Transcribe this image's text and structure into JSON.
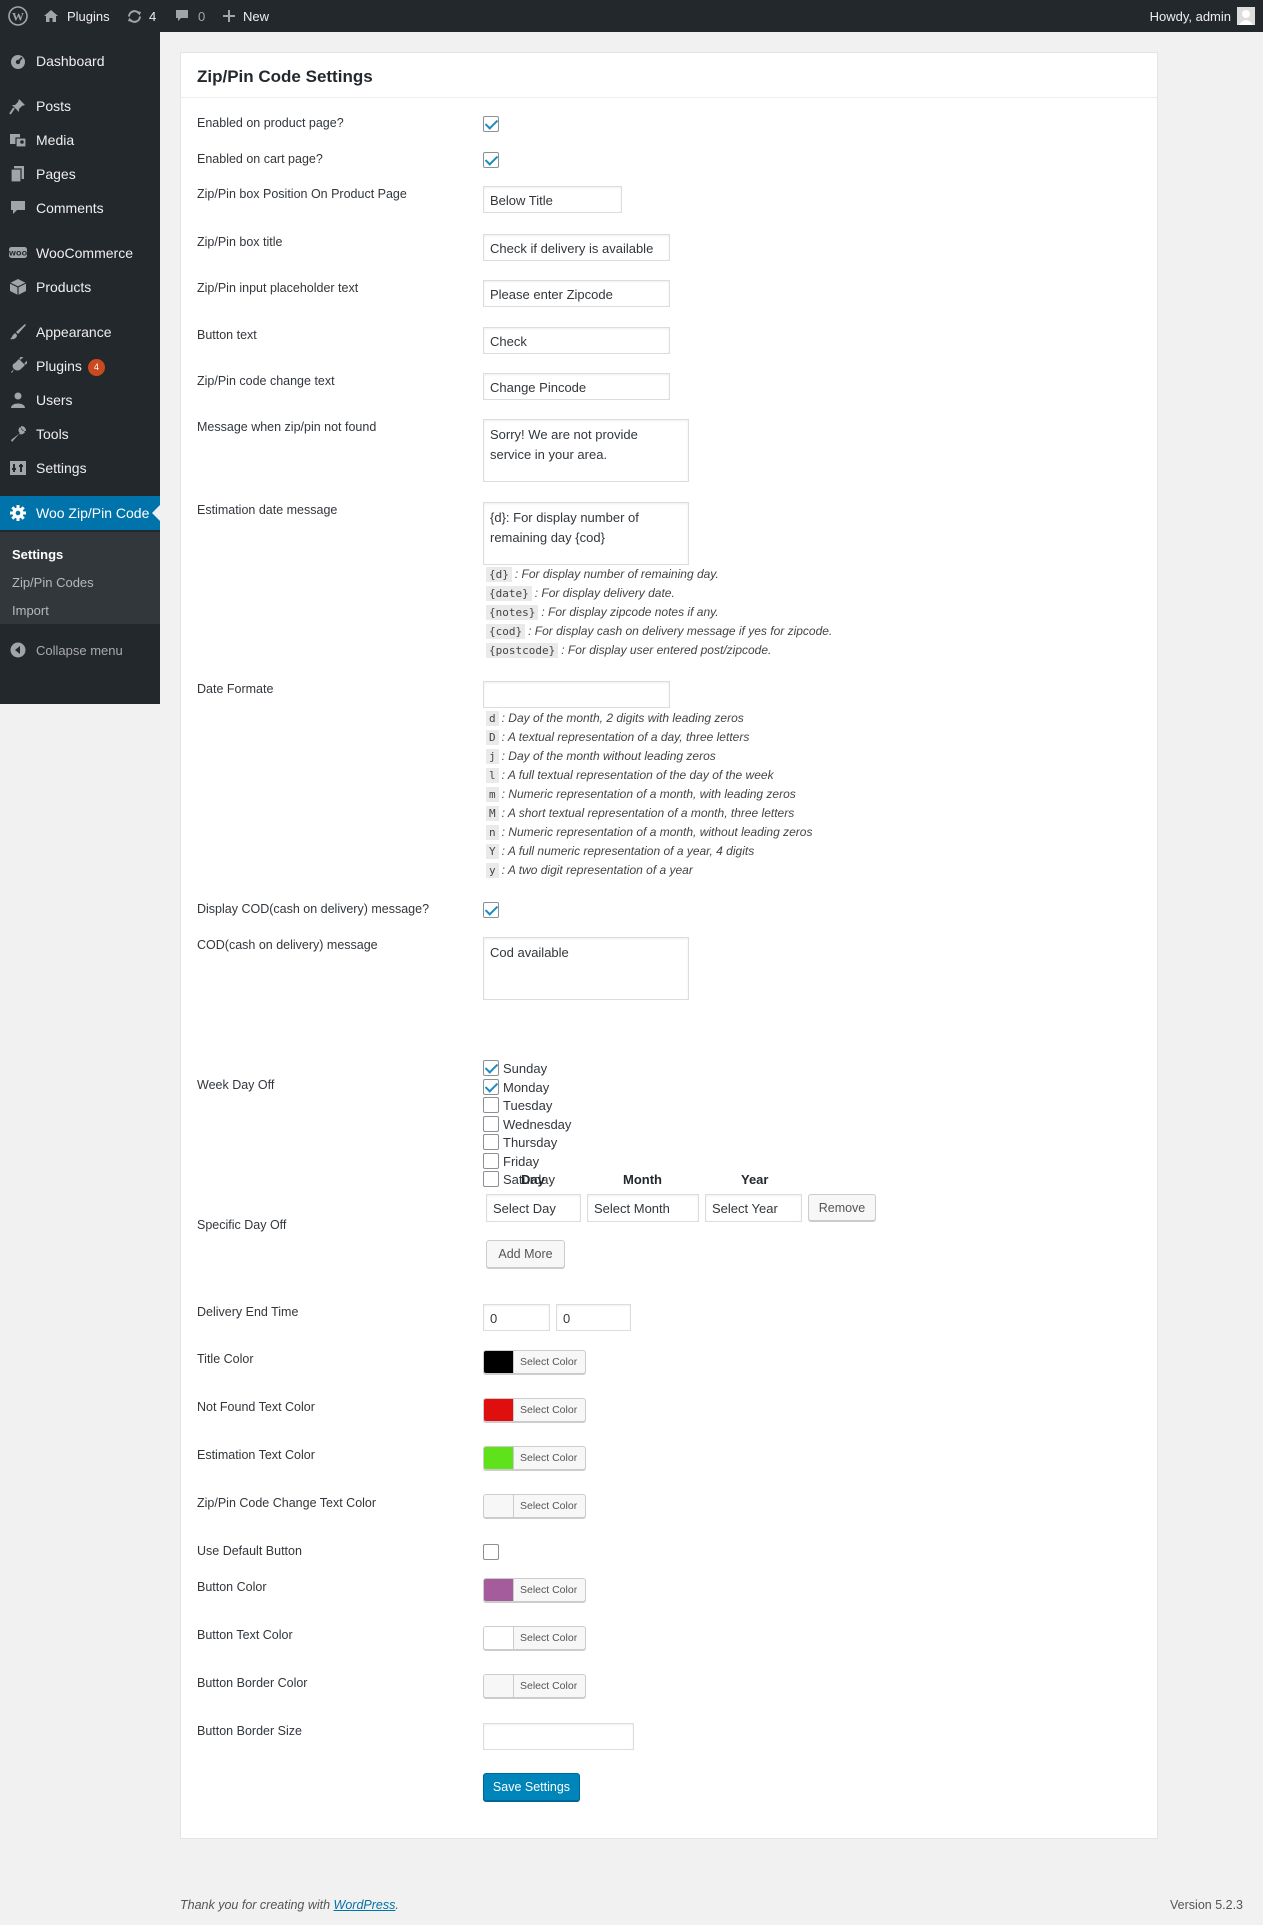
{
  "adminbar": {
    "site_label": "Plugins",
    "updates_count": "4",
    "comments_count": "0",
    "new_label": "New",
    "howdy": "Howdy, admin"
  },
  "sidebar": {
    "items": [
      {
        "label": "Dashboard",
        "icon": "dashboard-icon"
      },
      {
        "label": "Posts",
        "icon": "pin-icon"
      },
      {
        "label": "Media",
        "icon": "media-icon"
      },
      {
        "label": "Pages",
        "icon": "pages-icon"
      },
      {
        "label": "Comments",
        "icon": "comment-icon"
      },
      {
        "label": "WooCommerce",
        "icon": "woocommerce-icon"
      },
      {
        "label": "Products",
        "icon": "box-icon"
      },
      {
        "label": "Appearance",
        "icon": "brush-icon"
      },
      {
        "label": "Plugins",
        "icon": "plugin-icon",
        "badge": "4"
      },
      {
        "label": "Users",
        "icon": "user-icon"
      },
      {
        "label": "Tools",
        "icon": "wrench-icon"
      },
      {
        "label": "Settings",
        "icon": "settings-icon"
      },
      {
        "label": "Woo Zip/Pin Code",
        "icon": "gear-icon"
      }
    ],
    "submenu": [
      "Settings",
      "Zip/Pin Codes",
      "Import"
    ],
    "collapse_label": "Collapse menu"
  },
  "settings": {
    "title": "Zip/Pin Code Settings",
    "enabled_product_label": "Enabled on product page?",
    "enabled_product_checked": true,
    "enabled_cart_label": "Enabled on cart page?",
    "enabled_cart_checked": true,
    "box_position_label": "Zip/Pin box Position On Product Page",
    "box_position_value": "Below Title",
    "box_title_label": "Zip/Pin box title",
    "box_title_value": "Check if delivery is available",
    "placeholder_label": "Zip/Pin input placeholder text",
    "placeholder_value": "Please enter Zipcode",
    "button_text_label": "Button text",
    "button_text_value": "Check",
    "change_text_label": "Zip/Pin code change text",
    "change_text_value": "Change Pincode",
    "not_found_label": "Message when zip/pin not found",
    "not_found_value": "Sorry! We are not provide service in your area.",
    "estimation_label": "Estimation date message",
    "estimation_value": "{d}: For display number of remaining day {cod}",
    "estimation_hints": [
      {
        "code": "{d}",
        "text": ": For display number of remaining day."
      },
      {
        "code": "{date}",
        "text": ": For display delivery date."
      },
      {
        "code": "{notes}",
        "text": ": For display zipcode notes if any."
      },
      {
        "code": "{cod}",
        "text": ": For display cash on delivery message if yes for zipcode."
      },
      {
        "code": "{postcode}",
        "text": ": For display user entered post/zipcode."
      }
    ],
    "date_format_label": "Date Formate",
    "date_format_value": "",
    "date_hints": [
      {
        "code": "d",
        "text": ": Day of the month, 2 digits with leading zeros"
      },
      {
        "code": "D",
        "text": ": A textual representation of a day, three letters"
      },
      {
        "code": "j",
        "text": ": Day of the month without leading zeros"
      },
      {
        "code": "l",
        "text": ": A full textual representation of the day of the week"
      },
      {
        "code": "m",
        "text": ": Numeric representation of a month, with leading zeros"
      },
      {
        "code": "M",
        "text": ": A short textual representation of a month, three letters"
      },
      {
        "code": "n",
        "text": ": Numeric representation of a month, without leading zeros"
      },
      {
        "code": "Y",
        "text": ": A full numeric representation of a year, 4 digits"
      },
      {
        "code": "y",
        "text": ": A two digit representation of a year"
      }
    ],
    "display_cod_label": "Display COD(cash on delivery) message?",
    "display_cod_checked": true,
    "cod_message_label": "COD(cash on delivery) message",
    "cod_message_value": "Cod available",
    "week_day_off_label": "Week Day Off",
    "week_days": [
      {
        "label": "Sunday",
        "checked": true
      },
      {
        "label": "Monday",
        "checked": true
      },
      {
        "label": "Tuesday",
        "checked": false
      },
      {
        "label": "Wednesday",
        "checked": false
      },
      {
        "label": "Thursday",
        "checked": false
      },
      {
        "label": "Friday",
        "checked": false
      },
      {
        "label": "Saturday",
        "checked": false
      }
    ],
    "specific_day_off_label": "Specific Day Off",
    "col_day": "Day",
    "col_month": "Month",
    "col_year": "Year",
    "select_day": "Select Day",
    "select_month": "Select Month",
    "select_year": "Select Year",
    "remove_label": "Remove",
    "add_more_label": "Add More",
    "delivery_end_label": "Delivery End Time",
    "delivery_end_hour": "0",
    "delivery_end_minute": "0",
    "select_color_label": "Select Color",
    "colors": [
      {
        "label": "Title Color",
        "value": "#000000"
      },
      {
        "label": "Not Found Text Color",
        "value": "#e00f0f"
      },
      {
        "label": "Estimation Text Color",
        "value": "#5fe21a"
      },
      {
        "label": "Zip/Pin Code Change Text Color",
        "value": "#f7f7f7"
      }
    ],
    "use_default_button_label": "Use Default Button",
    "use_default_button_checked": false,
    "colors2": [
      {
        "label": "Button Color",
        "value": "#a45c9c"
      },
      {
        "label": "Button Text Color",
        "value": "#ffffff"
      },
      {
        "label": "Button Border Color",
        "value": "#f7f7f7"
      }
    ],
    "border_size_label": "Button Border Size",
    "border_size_value": "",
    "save_label": "Save Settings"
  },
  "footer": {
    "thanks_prefix": "Thank you for creating with ",
    "thanks_link": "WordPress",
    "thanks_suffix": ".",
    "version": "Version 5.2.3"
  }
}
